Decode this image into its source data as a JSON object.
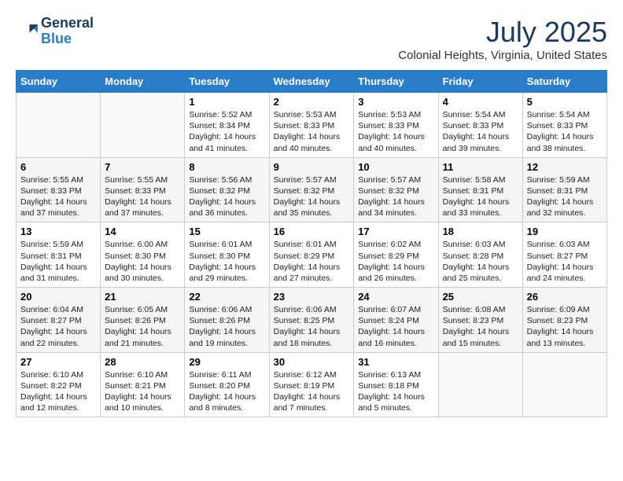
{
  "header": {
    "logo_line1": "General",
    "logo_line2": "Blue",
    "title": "July 2025",
    "location": "Colonial Heights, Virginia, United States"
  },
  "days_of_week": [
    "Sunday",
    "Monday",
    "Tuesday",
    "Wednesday",
    "Thursday",
    "Friday",
    "Saturday"
  ],
  "weeks": [
    [
      {
        "day": "",
        "info": ""
      },
      {
        "day": "",
        "info": ""
      },
      {
        "day": "1",
        "info": "Sunrise: 5:52 AM\nSunset: 8:34 PM\nDaylight: 14 hours\nand 41 minutes."
      },
      {
        "day": "2",
        "info": "Sunrise: 5:53 AM\nSunset: 8:33 PM\nDaylight: 14 hours\nand 40 minutes."
      },
      {
        "day": "3",
        "info": "Sunrise: 5:53 AM\nSunset: 8:33 PM\nDaylight: 14 hours\nand 40 minutes."
      },
      {
        "day": "4",
        "info": "Sunrise: 5:54 AM\nSunset: 8:33 PM\nDaylight: 14 hours\nand 39 minutes."
      },
      {
        "day": "5",
        "info": "Sunrise: 5:54 AM\nSunset: 8:33 PM\nDaylight: 14 hours\nand 38 minutes."
      }
    ],
    [
      {
        "day": "6",
        "info": "Sunrise: 5:55 AM\nSunset: 8:33 PM\nDaylight: 14 hours\nand 37 minutes."
      },
      {
        "day": "7",
        "info": "Sunrise: 5:55 AM\nSunset: 8:33 PM\nDaylight: 14 hours\nand 37 minutes."
      },
      {
        "day": "8",
        "info": "Sunrise: 5:56 AM\nSunset: 8:32 PM\nDaylight: 14 hours\nand 36 minutes."
      },
      {
        "day": "9",
        "info": "Sunrise: 5:57 AM\nSunset: 8:32 PM\nDaylight: 14 hours\nand 35 minutes."
      },
      {
        "day": "10",
        "info": "Sunrise: 5:57 AM\nSunset: 8:32 PM\nDaylight: 14 hours\nand 34 minutes."
      },
      {
        "day": "11",
        "info": "Sunrise: 5:58 AM\nSunset: 8:31 PM\nDaylight: 14 hours\nand 33 minutes."
      },
      {
        "day": "12",
        "info": "Sunrise: 5:59 AM\nSunset: 8:31 PM\nDaylight: 14 hours\nand 32 minutes."
      }
    ],
    [
      {
        "day": "13",
        "info": "Sunrise: 5:59 AM\nSunset: 8:31 PM\nDaylight: 14 hours\nand 31 minutes."
      },
      {
        "day": "14",
        "info": "Sunrise: 6:00 AM\nSunset: 8:30 PM\nDaylight: 14 hours\nand 30 minutes."
      },
      {
        "day": "15",
        "info": "Sunrise: 6:01 AM\nSunset: 8:30 PM\nDaylight: 14 hours\nand 29 minutes."
      },
      {
        "day": "16",
        "info": "Sunrise: 6:01 AM\nSunset: 8:29 PM\nDaylight: 14 hours\nand 27 minutes."
      },
      {
        "day": "17",
        "info": "Sunrise: 6:02 AM\nSunset: 8:29 PM\nDaylight: 14 hours\nand 26 minutes."
      },
      {
        "day": "18",
        "info": "Sunrise: 6:03 AM\nSunset: 8:28 PM\nDaylight: 14 hours\nand 25 minutes."
      },
      {
        "day": "19",
        "info": "Sunrise: 6:03 AM\nSunset: 8:27 PM\nDaylight: 14 hours\nand 24 minutes."
      }
    ],
    [
      {
        "day": "20",
        "info": "Sunrise: 6:04 AM\nSunset: 8:27 PM\nDaylight: 14 hours\nand 22 minutes."
      },
      {
        "day": "21",
        "info": "Sunrise: 6:05 AM\nSunset: 8:26 PM\nDaylight: 14 hours\nand 21 minutes."
      },
      {
        "day": "22",
        "info": "Sunrise: 6:06 AM\nSunset: 8:26 PM\nDaylight: 14 hours\nand 19 minutes."
      },
      {
        "day": "23",
        "info": "Sunrise: 6:06 AM\nSunset: 8:25 PM\nDaylight: 14 hours\nand 18 minutes."
      },
      {
        "day": "24",
        "info": "Sunrise: 6:07 AM\nSunset: 8:24 PM\nDaylight: 14 hours\nand 16 minutes."
      },
      {
        "day": "25",
        "info": "Sunrise: 6:08 AM\nSunset: 8:23 PM\nDaylight: 14 hours\nand 15 minutes."
      },
      {
        "day": "26",
        "info": "Sunrise: 6:09 AM\nSunset: 8:23 PM\nDaylight: 14 hours\nand 13 minutes."
      }
    ],
    [
      {
        "day": "27",
        "info": "Sunrise: 6:10 AM\nSunset: 8:22 PM\nDaylight: 14 hours\nand 12 minutes."
      },
      {
        "day": "28",
        "info": "Sunrise: 6:10 AM\nSunset: 8:21 PM\nDaylight: 14 hours\nand 10 minutes."
      },
      {
        "day": "29",
        "info": "Sunrise: 6:11 AM\nSunset: 8:20 PM\nDaylight: 14 hours\nand 8 minutes."
      },
      {
        "day": "30",
        "info": "Sunrise: 6:12 AM\nSunset: 8:19 PM\nDaylight: 14 hours\nand 7 minutes."
      },
      {
        "day": "31",
        "info": "Sunrise: 6:13 AM\nSunset: 8:18 PM\nDaylight: 14 hours\nand 5 minutes."
      },
      {
        "day": "",
        "info": ""
      },
      {
        "day": "",
        "info": ""
      }
    ]
  ]
}
